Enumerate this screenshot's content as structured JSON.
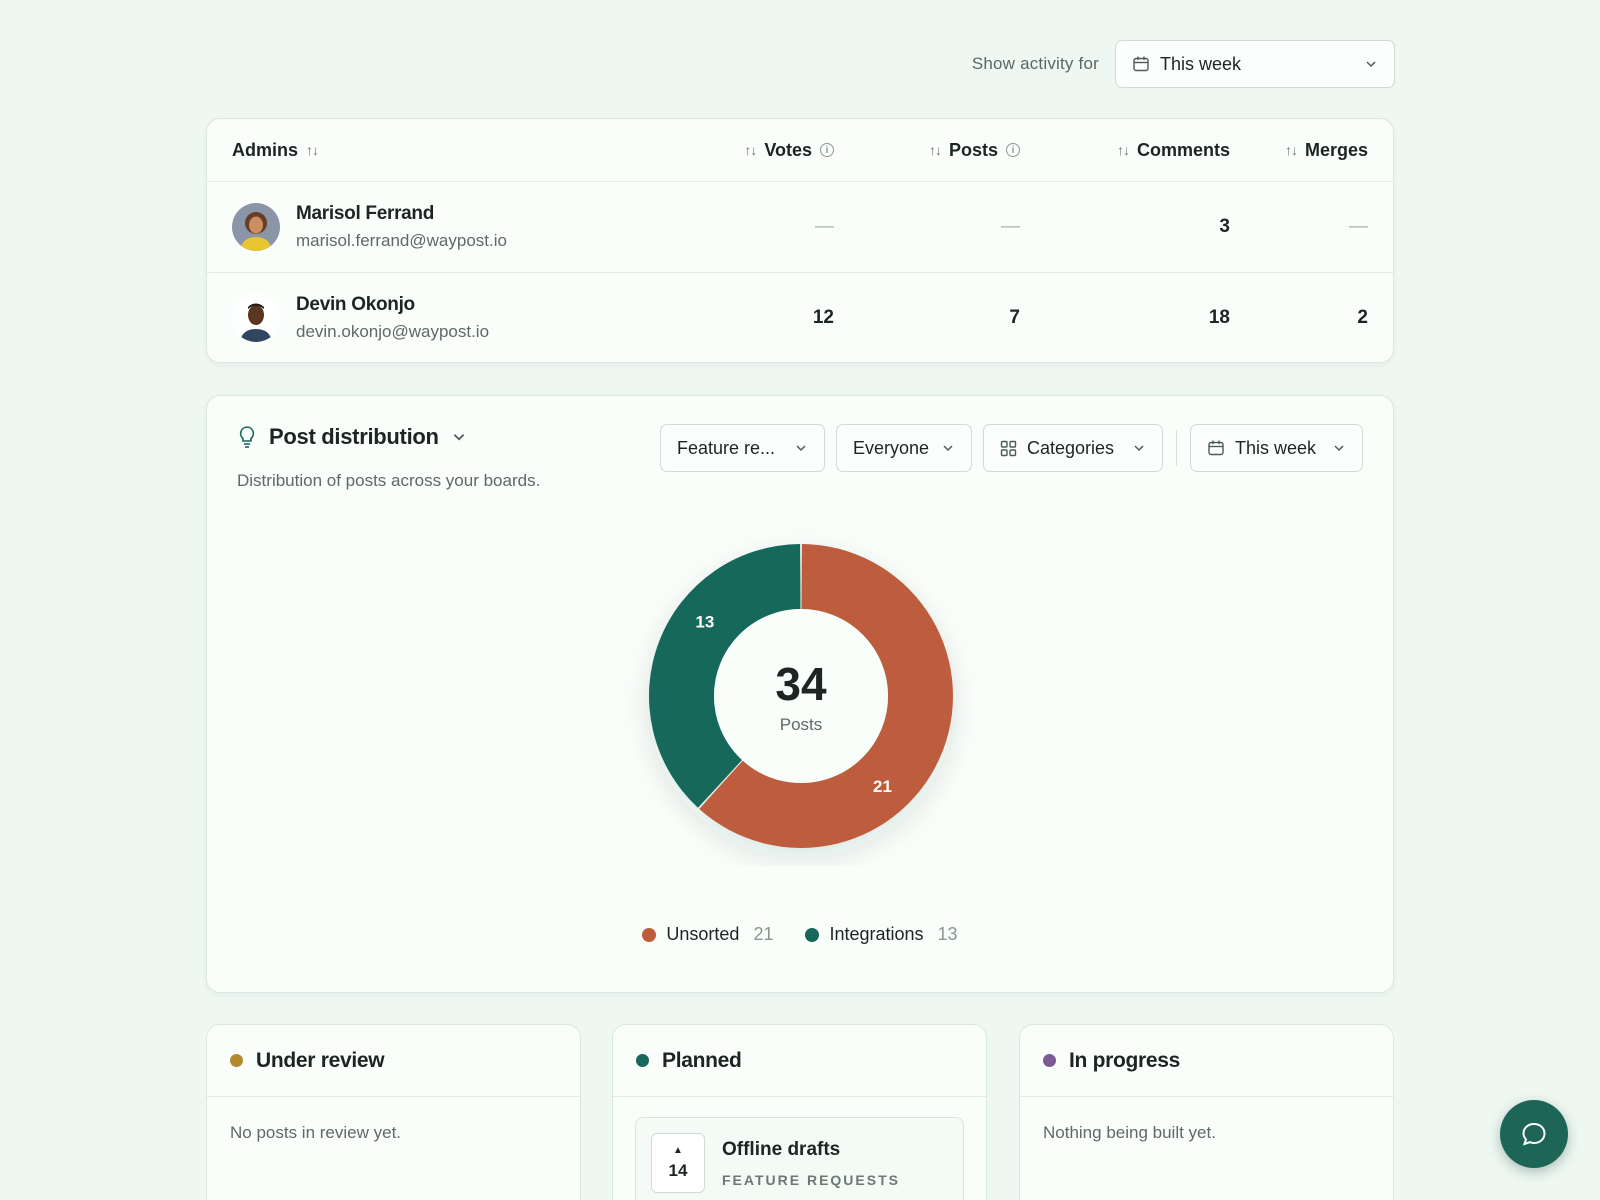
{
  "activity": {
    "label": "Show activity for",
    "range": "This week"
  },
  "admins_table": {
    "headers": {
      "admins": "Admins",
      "votes": "Votes",
      "posts": "Posts",
      "comments": "Comments",
      "merges": "Merges"
    },
    "rows": [
      {
        "name": "Marisol Ferrand",
        "email": "marisol.ferrand@waypost.io",
        "votes": "—",
        "posts": "—",
        "comments": "3",
        "merges": "—"
      },
      {
        "name": "Devin Okonjo",
        "email": "devin.okonjo@waypost.io",
        "votes": "12",
        "posts": "7",
        "comments": "18",
        "merges": "2"
      }
    ]
  },
  "distribution": {
    "title": "Post distribution",
    "subtitle": "Distribution of posts across your boards.",
    "filters": {
      "board": "Feature re...",
      "audience": "Everyone",
      "group_by": "Categories",
      "range": "This week"
    },
    "total": "34",
    "total_label": "Posts"
  },
  "chart_data": {
    "type": "pie",
    "categories": [
      "Unsorted",
      "Integrations"
    ],
    "values": [
      21,
      13
    ],
    "colors": [
      "#bd5d3c",
      "#17675a"
    ],
    "center_value": 34,
    "center_label": "Posts",
    "legend": "bottom"
  },
  "status_columns": [
    {
      "title": "Under review",
      "color": "#b48a2e",
      "empty": "No posts in review yet."
    },
    {
      "title": "Planned",
      "color": "#17675a",
      "post": {
        "votes": "14",
        "title": "Offline drafts",
        "board": "FEATURE REQUESTS"
      }
    },
    {
      "title": "In progress",
      "color": "#7c5a93",
      "empty": "Nothing being built yet."
    }
  ],
  "icons": {
    "calendar": "calendar-icon",
    "chevron": "chevron-down-icon",
    "sort": "sort-icon",
    "info": "info-icon",
    "bulb": "lightbulb-icon",
    "grid": "grid-icon",
    "chat": "chat-bubble-icon"
  }
}
